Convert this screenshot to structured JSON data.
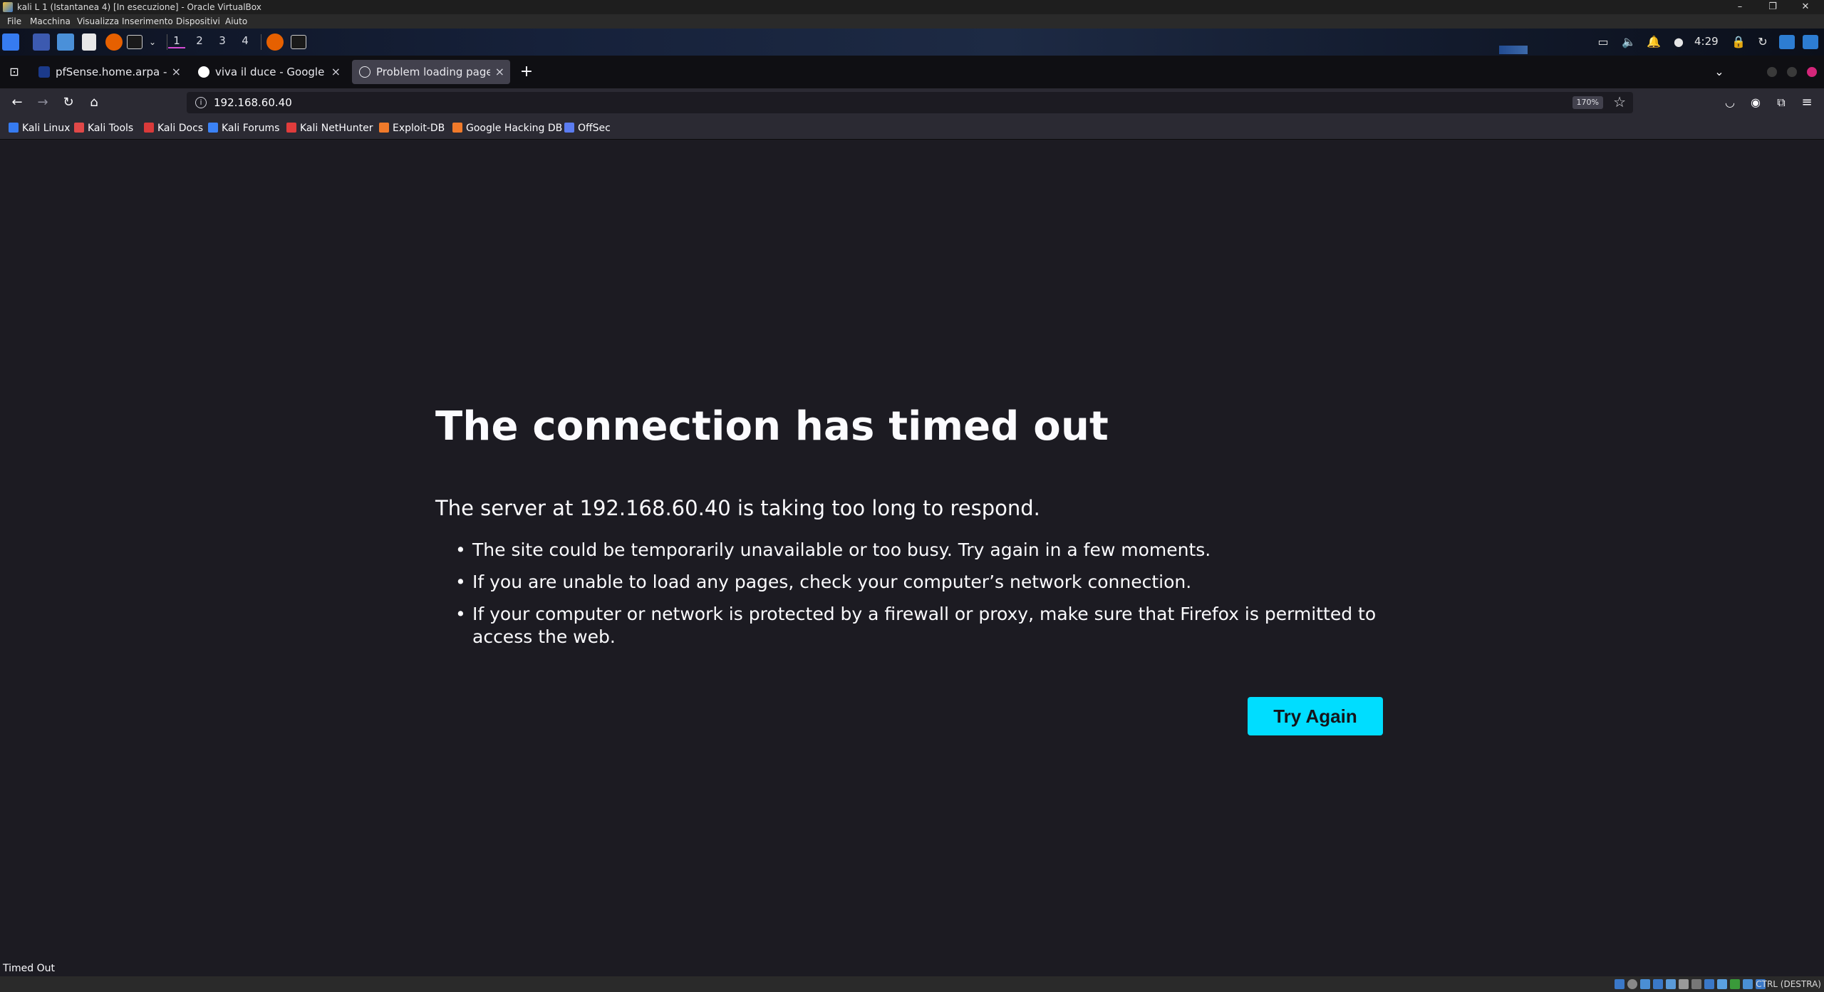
{
  "vbox": {
    "title": "kali L 1 (Istantanea 4) [In esecuzione] - Oracle VirtualBox",
    "menu": [
      "File",
      "Macchina",
      "Visualizza",
      "Inserimento",
      "Dispositivi",
      "Aiuto"
    ],
    "host_key": "CTRL (DESTRA)"
  },
  "panel": {
    "workspaces": [
      "1",
      "2",
      "3",
      "4"
    ],
    "active_workspace": "1",
    "clock": "4:29"
  },
  "tabs": [
    {
      "title": "pfSense.home.arpa - Serv",
      "icon": "pfsense-icon",
      "active": false
    },
    {
      "title": "viva il duce - Google Searc",
      "icon": "google-icon",
      "active": false
    },
    {
      "title": "Problem loading page",
      "icon": "info-icon",
      "active": true
    }
  ],
  "navbar": {
    "url": "192.168.60.40",
    "zoom": "170%"
  },
  "bookmarks": [
    {
      "label": "Kali Linux",
      "icon": "kali-dragon-icon",
      "color": "#367bf0"
    },
    {
      "label": "Kali Tools",
      "icon": "kali-tools-icon",
      "color": "#e04848"
    },
    {
      "label": "Kali Docs",
      "icon": "kali-docs-icon",
      "color": "#d93a3a"
    },
    {
      "label": "Kali Forums",
      "icon": "kali-forums-icon",
      "color": "#3b82f6"
    },
    {
      "label": "Kali NetHunter",
      "icon": "nethunter-icon",
      "color": "#e03c3c"
    },
    {
      "label": "Exploit-DB",
      "icon": "exploitdb-icon",
      "color": "#f07a2a"
    },
    {
      "label": "Google Hacking DB",
      "icon": "ghdb-icon",
      "color": "#f07a2a"
    },
    {
      "label": "OffSec",
      "icon": "offsec-icon",
      "color": "#5b7cf0"
    }
  ],
  "error": {
    "title": "The connection has timed out",
    "subtitle": "The server at 192.168.60.40 is taking too long to respond.",
    "items": [
      "The site could be temporarily unavailable or too busy. Try again in a few moments.",
      "If you are unable to load any pages, check your computer’s network connection.",
      "If your computer or network is protected by a firewall or proxy, make sure that Firefox is permitted to access the web."
    ],
    "button": "Try Again"
  },
  "status": "Timed Out",
  "colors": {
    "accent": "#00ddff",
    "page_bg": "#1c1b22",
    "toolbar_bg": "#2b2a33"
  }
}
